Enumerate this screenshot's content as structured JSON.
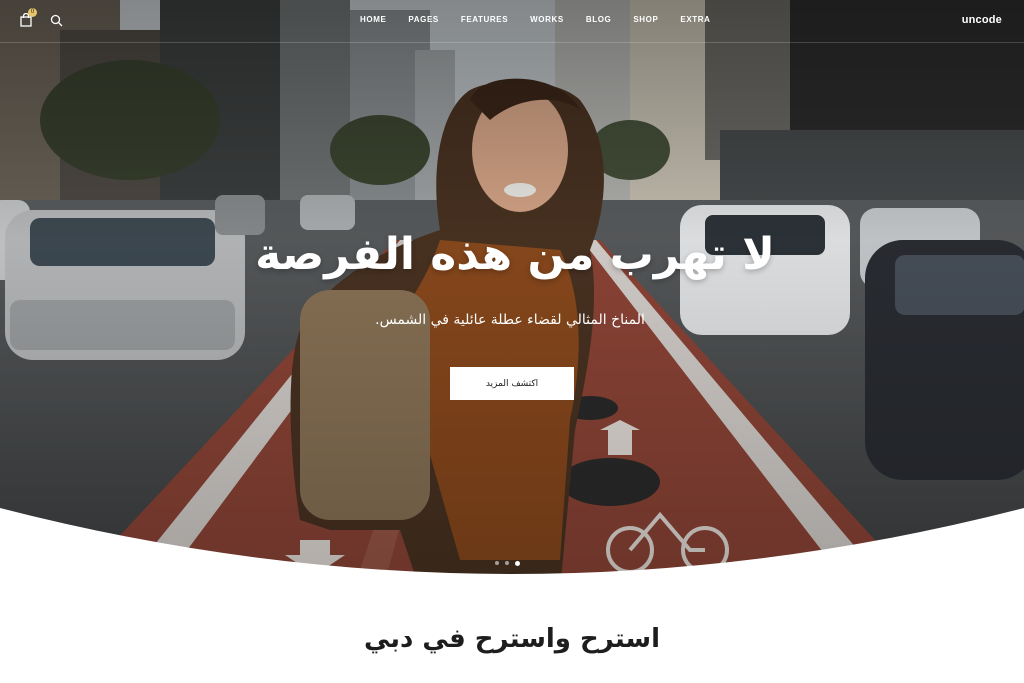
{
  "header": {
    "logo": "uncode",
    "cart_count": "0",
    "menu": [
      "HOME",
      "PAGES",
      "FEATURES",
      "WORKS",
      "BLOG",
      "SHOP",
      "EXTRA"
    ]
  },
  "hero": {
    "title": "لا تهرب من هذه الفرصة",
    "subtitle": "المناخ المثالي لقضاء عطلة عائلية في الشمس.",
    "cta_label": "اكتشف المزيد",
    "slides_total": 3,
    "slide_active": 3
  },
  "section": {
    "title": "استرح واسترح في دبي"
  },
  "colors": {
    "accent_badge": "#e9c46a",
    "text_dark": "#1d1d1d",
    "bike_lane": "#9a4a3c"
  },
  "icons": [
    "cart-icon",
    "search-icon"
  ]
}
